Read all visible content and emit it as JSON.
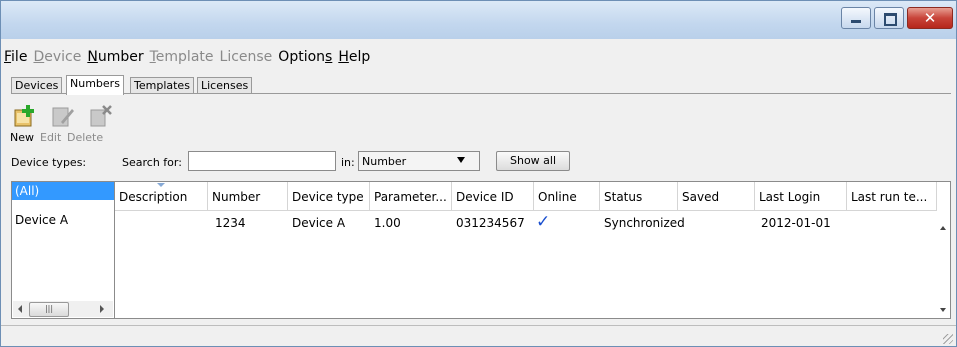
{
  "menu": [
    {
      "label": "File",
      "ul": "F",
      "disabled": false
    },
    {
      "label": "Device",
      "ul": "D",
      "disabled": true
    },
    {
      "label": "Number",
      "ul": "N",
      "disabled": false
    },
    {
      "label": "Template",
      "ul": "T",
      "disabled": true
    },
    {
      "label": "License",
      "ul": "",
      "disabled": true
    },
    {
      "label": "Options",
      "ul": "s",
      "disabled": false
    },
    {
      "label": "Help",
      "ul": "H",
      "disabled": false
    }
  ],
  "tabs": [
    "Devices",
    "Numbers",
    "Templates",
    "Licenses"
  ],
  "active_tab": "Numbers",
  "toolbar": {
    "new": "New",
    "edit": "Edit",
    "delete": "Delete"
  },
  "filter": {
    "device_types_label": "Device types:",
    "search_label": "Search for:",
    "search_value": "",
    "in_label": "in:",
    "in_value": "Number",
    "show_all": "Show all"
  },
  "device_list": {
    "selected": "(All)",
    "items": [
      "Device A"
    ]
  },
  "table": {
    "columns": [
      "Description",
      "Number",
      "Device type",
      "Parameter...",
      "Device ID",
      "Online",
      "Status",
      "Saved",
      "Last Login",
      "Last run te..."
    ],
    "rows": [
      {
        "description": "",
        "number": "1234",
        "device_type": "Device A",
        "parameter": "1.00",
        "device_id": "031234567",
        "online": "✓",
        "status": "Synchronized",
        "saved": "",
        "last_login": "2012-01-01",
        "last_run": ""
      }
    ]
  },
  "colors": {
    "selection": "#3399ff",
    "check": "#1a4fcf"
  }
}
